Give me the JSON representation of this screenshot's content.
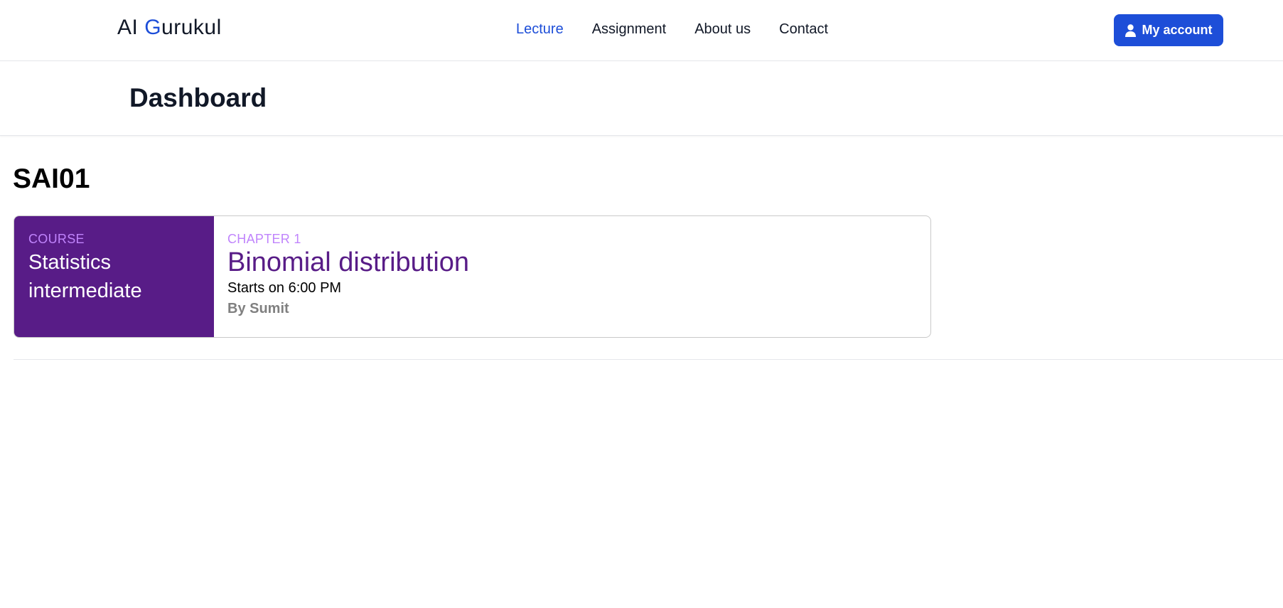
{
  "nav": {
    "brand_prefix": "AI ",
    "brand_accent": "G",
    "brand_suffix": "urukul",
    "links": [
      {
        "label": "Lecture",
        "active": true
      },
      {
        "label": "Assignment",
        "active": false
      },
      {
        "label": "About us",
        "active": false
      },
      {
        "label": "Contact",
        "active": false
      }
    ],
    "account_button": "My account",
    "account_icon": "user-icon"
  },
  "header": {
    "title": "Dashboard"
  },
  "section": {
    "title": "SAI01"
  },
  "lecture": {
    "course_kicker": "COURSE",
    "course_name": "Statistics intermediate",
    "chapter_kicker": "CHAPTER 1",
    "chapter_title": "Binomial distribution",
    "start_time": "Starts on 6:00 PM",
    "author": "By Sumit"
  },
  "colors": {
    "primary_blue": "#1d4ed8",
    "course_purple": "#581c87",
    "kicker_purple": "#c084fc",
    "author_gray": "#808080"
  }
}
